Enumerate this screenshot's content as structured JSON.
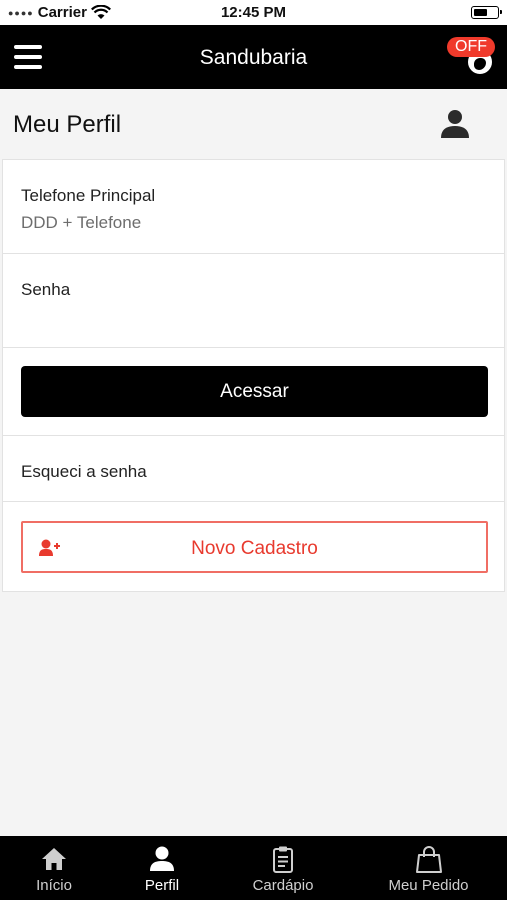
{
  "status_bar": {
    "carrier": "Carrier",
    "time": "12:45 PM"
  },
  "header": {
    "title": "Sandubaria",
    "status_badge": "OFF"
  },
  "page": {
    "title": "Meu Perfil"
  },
  "form": {
    "phone_label": "Telefone Principal",
    "phone_placeholder": "DDD + Telefone",
    "password_label": "Senha",
    "password_value": "",
    "login_button": "Acessar",
    "forgot_password": "Esqueci a senha",
    "register_button": "Novo Cadastro"
  },
  "tabs": [
    {
      "label": "Início",
      "icon": "home-icon",
      "active": false
    },
    {
      "label": "Perfil",
      "icon": "user-icon",
      "active": true
    },
    {
      "label": "Cardápio",
      "icon": "clipboard-icon",
      "active": false
    },
    {
      "label": "Meu Pedido",
      "icon": "shopping-bag-icon",
      "active": false
    }
  ],
  "colors": {
    "accent": "#e83a2e",
    "header_bg": "#000000",
    "badge": "#f03a2b"
  }
}
